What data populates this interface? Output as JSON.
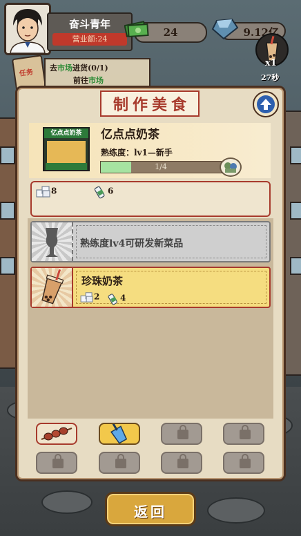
{
  "player": {
    "name": "奋斗青年",
    "revenue": "营业额:24"
  },
  "stats": {
    "cash": "24",
    "gems": "9.12亿"
  },
  "tea_counter": {
    "count": "x1",
    "timer": "27秒"
  },
  "task": {
    "board_label": "任务",
    "line1_prefix": "去",
    "line1_highlight": "市场",
    "line1_suffix": "进货(0/1)",
    "line2_prefix": "前往",
    "line2_highlight": "市场"
  },
  "panel": {
    "title": "制作美食",
    "shop": {
      "sign": "亿点点奶茶",
      "name": "亿点点奶茶",
      "level": "熟练度：lv1—新手",
      "progress_text": "1/4",
      "progress_fraction": 0.25
    },
    "ingredients": [
      {
        "icon": "sugar-icon",
        "count": "8"
      },
      {
        "icon": "milk-bottle-icon",
        "count": "6"
      }
    ],
    "recipes": [
      {
        "state": "locked",
        "text": "熟练度lv4可研发新菜品"
      },
      {
        "state": "available",
        "name": "珍珠奶茶",
        "requirements": [
          {
            "icon": "sugar-icon",
            "count": "2"
          },
          {
            "icon": "milk-bottle-icon",
            "count": "4"
          }
        ]
      }
    ],
    "categories": [
      {
        "icon": "skewer-icon",
        "state": "normal"
      },
      {
        "icon": "milk-tea-cup-icon",
        "state": "selected"
      },
      {
        "icon": "lock-icon",
        "state": "locked"
      },
      {
        "icon": "lock-icon",
        "state": "locked"
      },
      {
        "icon": "lock-icon",
        "state": "locked"
      },
      {
        "icon": "lock-icon",
        "state": "locked"
      },
      {
        "icon": "lock-icon",
        "state": "locked"
      },
      {
        "icon": "lock-icon",
        "state": "locked"
      }
    ]
  },
  "back_label": "返回",
  "colors": {
    "accent_red": "#a73a2c",
    "selected_gold": "#f2c84b",
    "progress_green": "#a6e3a1"
  }
}
